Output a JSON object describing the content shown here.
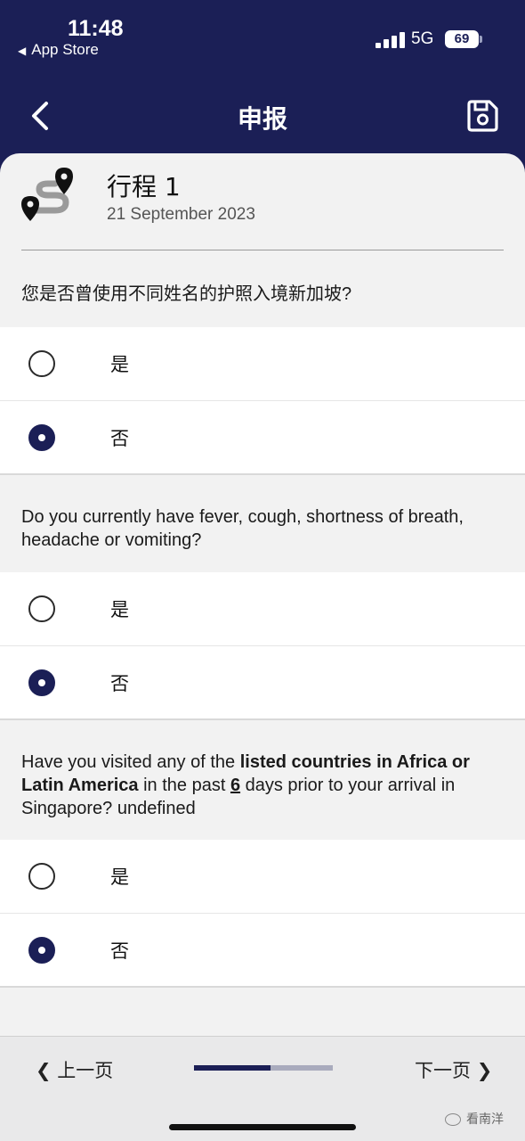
{
  "status_bar": {
    "time": "11:48",
    "back_app": "App Store",
    "network": "5G",
    "battery": "69"
  },
  "nav": {
    "title": "申报",
    "back_icon": "chevron-left-icon",
    "save_icon": "save-floppy-icon"
  },
  "trip": {
    "title": "行程 1",
    "date": "21 September 2023",
    "icon": "route-pins-icon"
  },
  "questions": [
    {
      "text": "您是否曾使用不同姓名的护照入境新加坡?",
      "options": [
        {
          "label": "是",
          "selected": false
        },
        {
          "label": "否",
          "selected": true
        }
      ]
    },
    {
      "text": "Do you currently have fever, cough, shortness of breath, headache or vomiting?",
      "options": [
        {
          "label": "是",
          "selected": false
        },
        {
          "label": "否",
          "selected": true
        }
      ]
    },
    {
      "text_parts": {
        "a": "Have you visited any of the ",
        "b": "listed countries in Africa or Latin America",
        "c": " in the past ",
        "d": "6",
        "e": " days prior to your arrival in Singapore? undefined"
      },
      "options": [
        {
          "label": "是",
          "selected": false
        },
        {
          "label": "否",
          "selected": true
        }
      ]
    }
  ],
  "footer": {
    "prev_label": "上一页",
    "next_label": "下一页",
    "progress_fraction": 0.55,
    "watermark": "看南洋"
  },
  "colors": {
    "brand": "#1b1f56",
    "background": "#f2f2f2"
  }
}
